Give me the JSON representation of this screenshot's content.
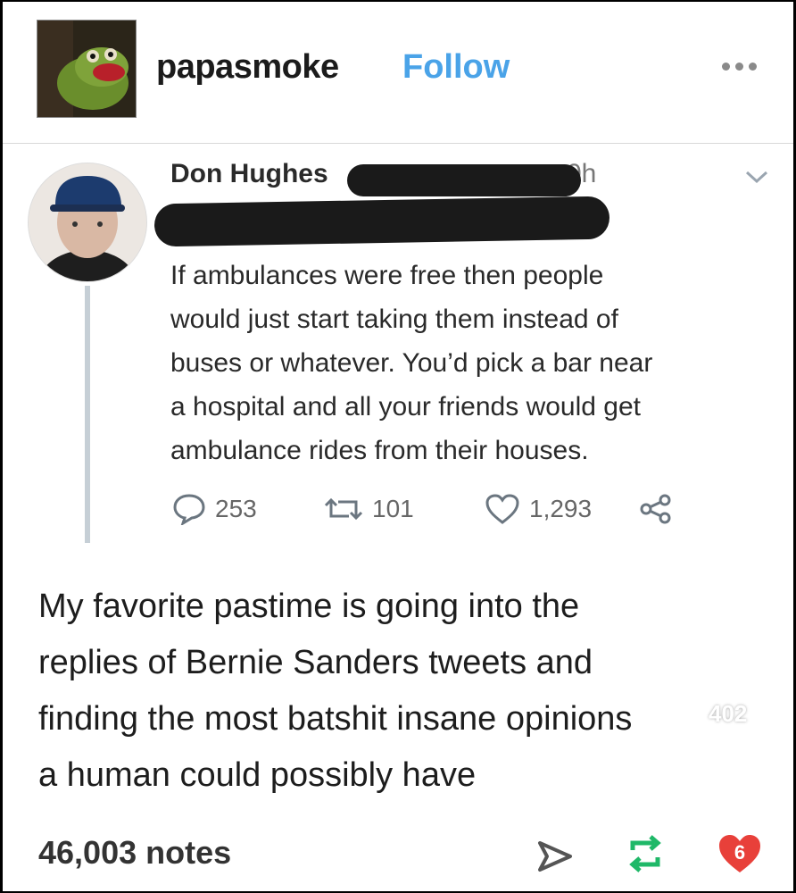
{
  "post": {
    "username": "papasmoke",
    "follow_label": "Follow",
    "caption_lines": [
      "My favorite pastime is going into the",
      "replies of Bernie Sanders tweets and",
      "finding the most batshit insane opinions",
      "a human could possibly have"
    ],
    "notes": "46,003 notes"
  },
  "tweet": {
    "name": "Don Hughes",
    "time_fragment": "0h",
    "text_lines": [
      "If ambulances were free then people",
      "would just start taking them instead of",
      "buses or whatever. You’d pick a bar near",
      "a hospital and all your friends would get",
      "ambulance rides from their houses."
    ],
    "replies": "253",
    "retweets": "101",
    "likes": "1,293"
  },
  "overlay": {
    "like_count": "402",
    "like_badge_count": "6"
  },
  "colors": {
    "follow_blue": "#4aa3e8",
    "reblog_green": "#1fb868",
    "like_red": "#e8403a"
  },
  "icons": [
    "more-dots-icon",
    "chevron-down-icon",
    "reply-icon",
    "retweet-icon",
    "heart-icon",
    "share-icon",
    "comment-icon",
    "send-icon",
    "reblog-icon"
  ]
}
